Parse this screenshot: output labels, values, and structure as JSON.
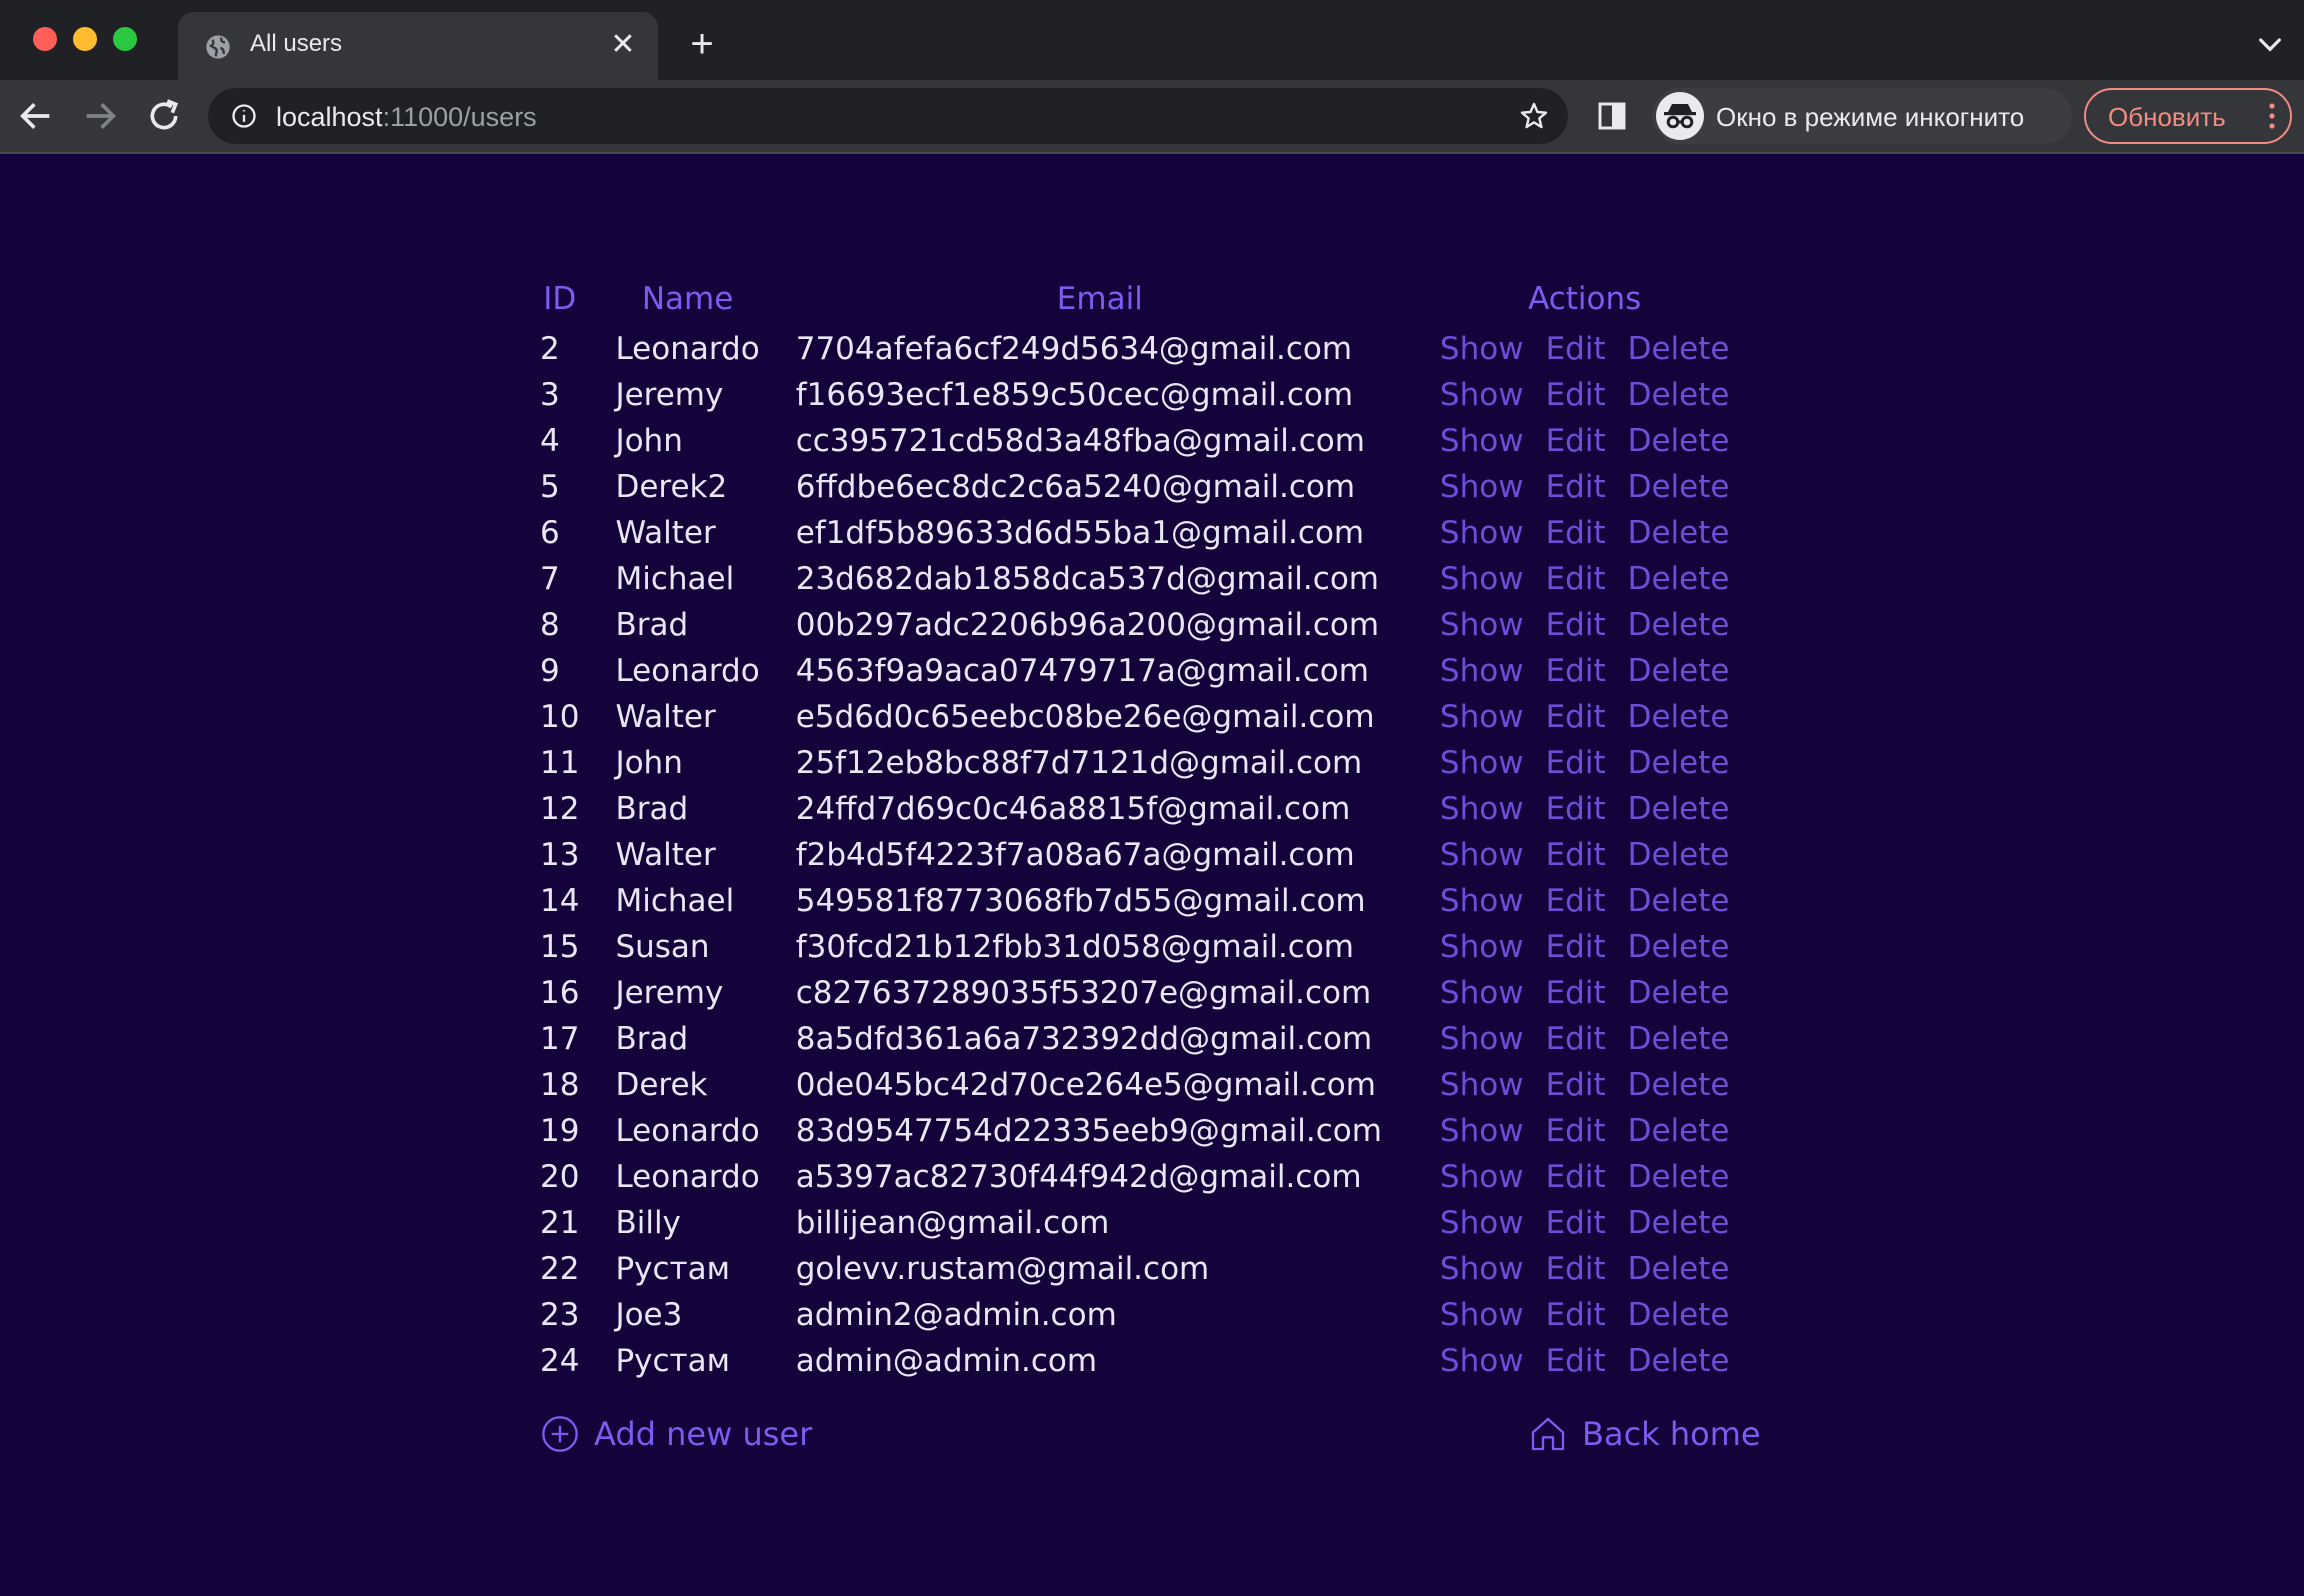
{
  "browser": {
    "tab_title": "All users",
    "url_host": "localhost",
    "url_path": ":11000/users",
    "incognito_label": "Окно в режиме инкогнито",
    "update_label": "Обновить",
    "icons": [
      "globe-icon",
      "close-icon",
      "plus-icon",
      "chevron-down-icon",
      "back-arrow-icon",
      "forward-arrow-icon",
      "reload-icon",
      "info-icon",
      "star-icon",
      "side-panel-icon",
      "incognito-icon",
      "more-vert-icon"
    ]
  },
  "table": {
    "headers": {
      "id": "ID",
      "name": "Name",
      "email": "Email",
      "actions": "Actions"
    },
    "action_labels": {
      "show": "Show",
      "edit": "Edit",
      "delete": "Delete"
    },
    "rows": [
      {
        "id": "2",
        "name": "Leonardo",
        "email": "7704afefa6cf249d5634@gmail.com"
      },
      {
        "id": "3",
        "name": "Jeremy",
        "email": "f16693ecf1e859c50cec@gmail.com"
      },
      {
        "id": "4",
        "name": "John",
        "email": "cc395721cd58d3a48fba@gmail.com"
      },
      {
        "id": "5",
        "name": "Derek2",
        "email": "6ffdbe6ec8dc2c6a5240@gmail.com"
      },
      {
        "id": "6",
        "name": "Walter",
        "email": "ef1df5b89633d6d55ba1@gmail.com"
      },
      {
        "id": "7",
        "name": "Michael",
        "email": "23d682dab1858dca537d@gmail.com"
      },
      {
        "id": "8",
        "name": "Brad",
        "email": "00b297adc2206b96a200@gmail.com"
      },
      {
        "id": "9",
        "name": "Leonardo",
        "email": "4563f9a9aca07479717a@gmail.com"
      },
      {
        "id": "10",
        "name": "Walter",
        "email": "e5d6d0c65eebc08be26e@gmail.com"
      },
      {
        "id": "11",
        "name": "John",
        "email": "25f12eb8bc88f7d7121d@gmail.com"
      },
      {
        "id": "12",
        "name": "Brad",
        "email": "24ffd7d69c0c46a8815f@gmail.com"
      },
      {
        "id": "13",
        "name": "Walter",
        "email": "f2b4d5f4223f7a08a67a@gmail.com"
      },
      {
        "id": "14",
        "name": "Michael",
        "email": "549581f8773068fb7d55@gmail.com"
      },
      {
        "id": "15",
        "name": "Susan",
        "email": "f30fcd21b12fbb31d058@gmail.com"
      },
      {
        "id": "16",
        "name": "Jeremy",
        "email": "c827637289035f53207e@gmail.com"
      },
      {
        "id": "17",
        "name": "Brad",
        "email": "8a5dfd361a6a732392dd@gmail.com"
      },
      {
        "id": "18",
        "name": "Derek",
        "email": "0de045bc42d70ce264e5@gmail.com"
      },
      {
        "id": "19",
        "name": "Leonardo",
        "email": "83d9547754d22335eeb9@gmail.com"
      },
      {
        "id": "20",
        "name": "Leonardo",
        "email": "a5397ac82730f44f942d@gmail.com"
      },
      {
        "id": "21",
        "name": "Billy",
        "email": "billijean@gmail.com"
      },
      {
        "id": "22",
        "name": "Рустам",
        "email": "golevv.rustam@gmail.com"
      },
      {
        "id": "23",
        "name": "Joe3",
        "email": "admin2@admin.com"
      },
      {
        "id": "24",
        "name": "Рустам",
        "email": "admin@admin.com"
      }
    ]
  },
  "footer": {
    "add_label": "Add new user",
    "home_label": "Back home"
  },
  "colors": {
    "page_bg": "#14023a",
    "accent": "#7b5cf0",
    "text": "#e9e6f5"
  }
}
